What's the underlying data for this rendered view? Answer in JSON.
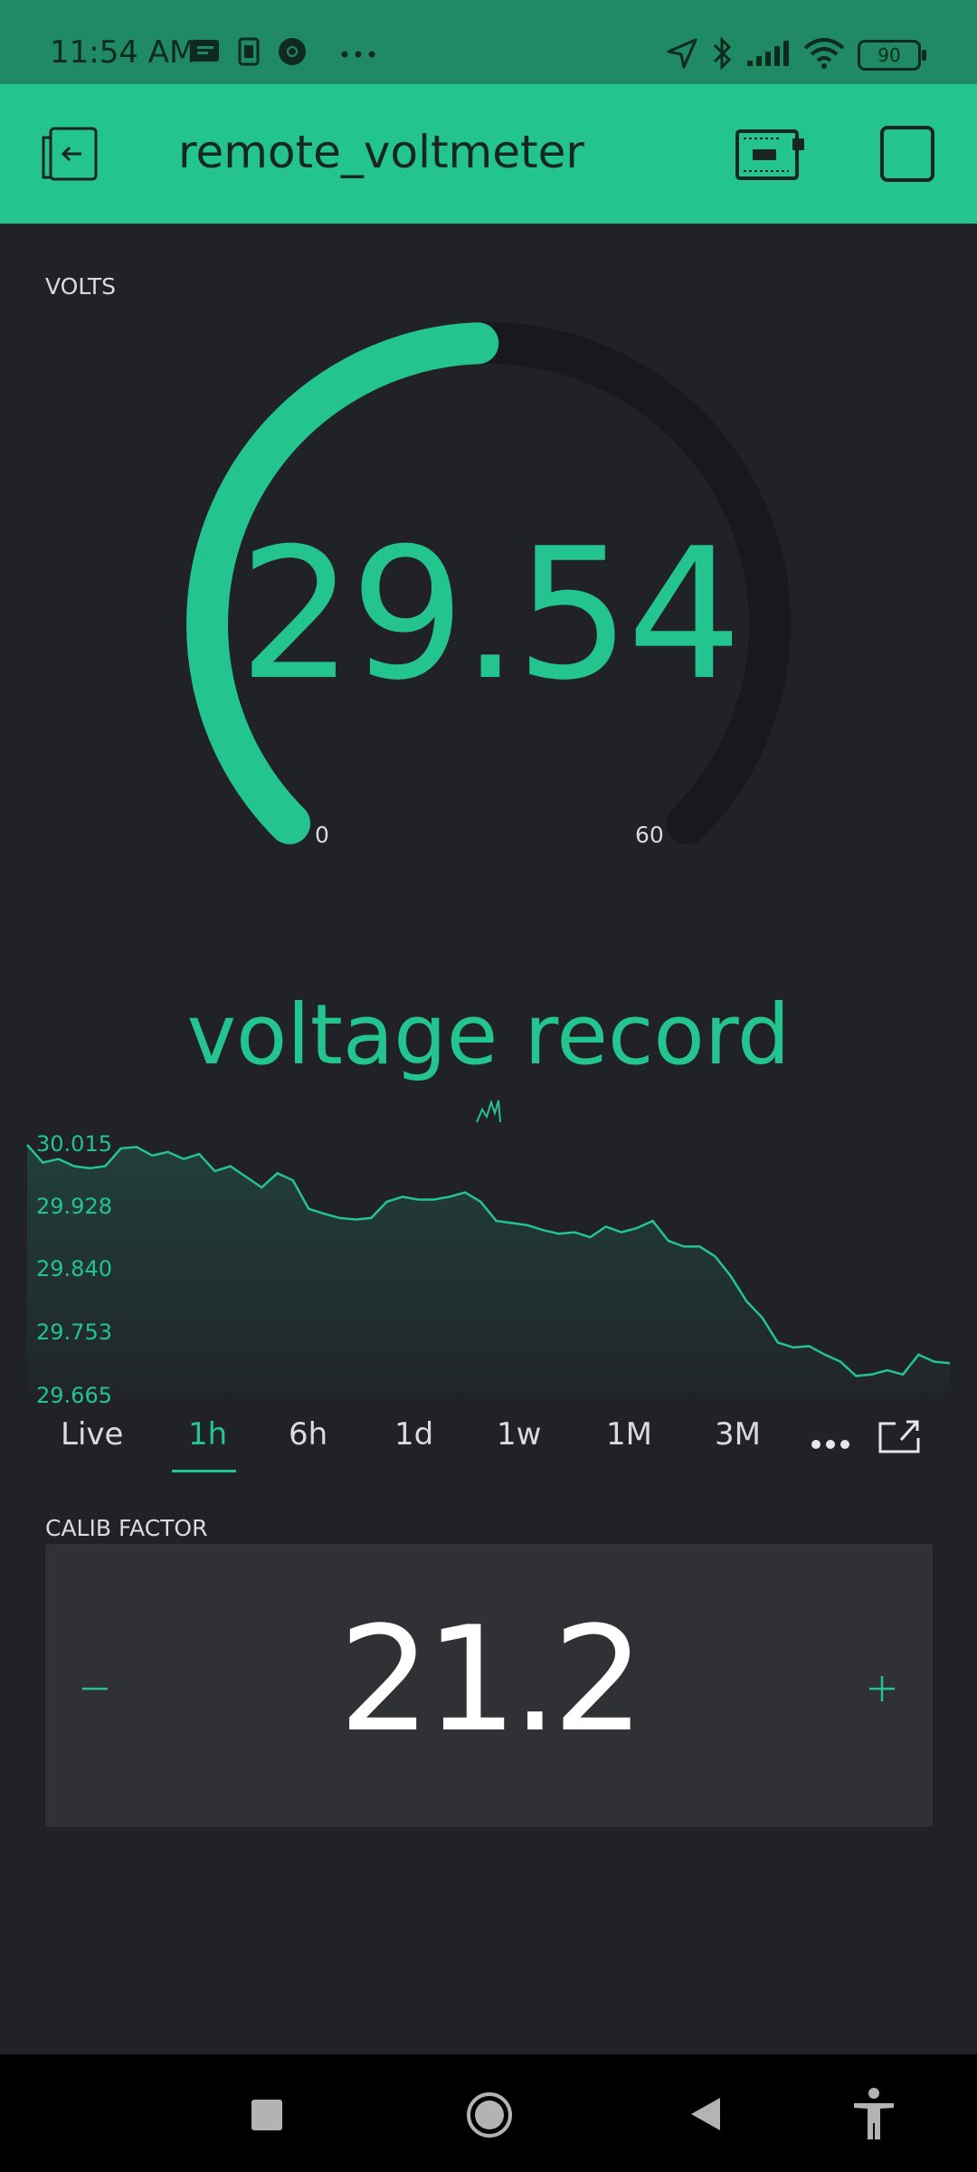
{
  "status_bar": {
    "time": "11:54 AM",
    "battery": "90",
    "icons": [
      "message-icon",
      "sim-card-icon",
      "chrome-icon",
      "more-dots-icon",
      "location-icon",
      "bluetooth-icon",
      "signal-icon",
      "wifi-icon",
      "battery-icon"
    ]
  },
  "app_bar": {
    "title": "remote_voltmeter",
    "icons": [
      "back-exit-icon",
      "device-board-icon",
      "stop-square-icon"
    ]
  },
  "gauge": {
    "label": "VOLTS",
    "value": "29.54",
    "min": "0",
    "max": "60",
    "level_fraction": 0.492,
    "color": "#23c48e",
    "track_color": "#18191c"
  },
  "chart": {
    "title": "voltage record",
    "tabs": [
      "Live",
      "1h",
      "6h",
      "1d",
      "1w",
      "1M",
      "3M"
    ],
    "active_tab": "1h"
  },
  "chart_data": {
    "type": "area",
    "title": "voltage record",
    "ylim": [
      29.665,
      30.015
    ],
    "yticks": [
      "30.015",
      "29.928",
      "29.840",
      "29.753",
      "29.665"
    ],
    "values": [
      30.015,
      29.99,
      29.995,
      29.985,
      29.982,
      29.985,
      30.01,
      30.012,
      30.0,
      30.005,
      29.995,
      30.002,
      29.978,
      29.985,
      29.97,
      29.955,
      29.975,
      29.965,
      29.925,
      29.918,
      29.912,
      29.91,
      29.912,
      29.935,
      29.942,
      29.938,
      29.938,
      29.942,
      29.948,
      29.935,
      29.908,
      29.905,
      29.902,
      29.895,
      29.89,
      29.892,
      29.885,
      29.9,
      29.892,
      29.898,
      29.908,
      29.88,
      29.872,
      29.872,
      29.858,
      29.83,
      29.795,
      29.772,
      29.737,
      29.73,
      29.732,
      29.72,
      29.71,
      29.69,
      29.692,
      29.698,
      29.692,
      29.72,
      29.71,
      29.708
    ],
    "line_color": "#23c48e"
  },
  "stepper": {
    "label": "CALIB FACTOR",
    "value": "21.2",
    "minus": "−",
    "plus": "+"
  },
  "nav_bar": {
    "icons": [
      "recents-square-icon",
      "home-circle-icon",
      "back-triangle-icon",
      "accessibility-icon"
    ]
  }
}
